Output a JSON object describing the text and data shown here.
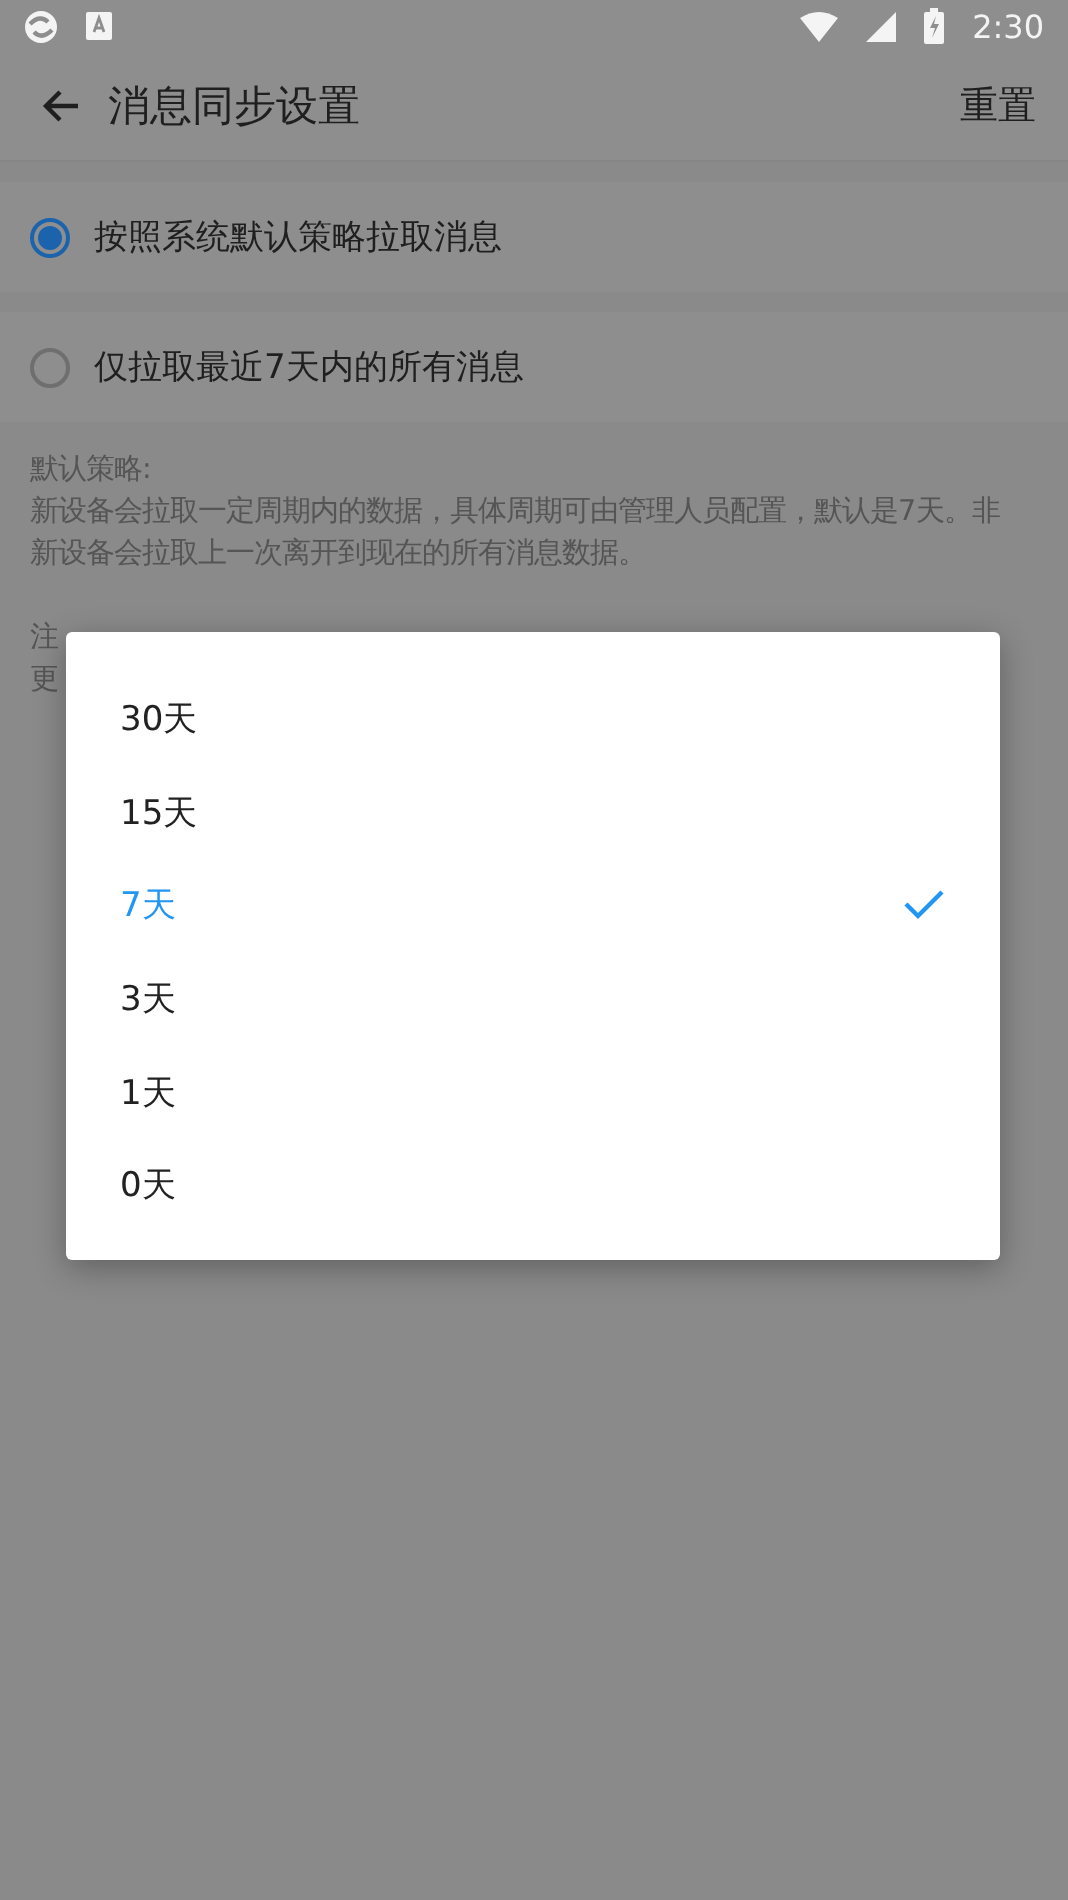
{
  "status_bar": {
    "time": "2:30"
  },
  "app_bar": {
    "title": "消息同步设置",
    "action": "重置"
  },
  "options": [
    {
      "label": "按照系统默认策略拉取消息",
      "selected": true
    },
    {
      "label": "仅拉取最近7天内的所有消息",
      "selected": false
    }
  ],
  "notes": [
    {
      "title": "默认策略:",
      "body": "新设备会拉取一定周期内的数据，具体周期可由管理人员配置，默认是7天。非新设备会拉取上一次离开到现在的所有消息数据。"
    },
    {
      "title": "注",
      "body": "更"
    }
  ],
  "dialog": {
    "items": [
      {
        "label": "30天",
        "selected": false
      },
      {
        "label": "15天",
        "selected": false
      },
      {
        "label": "7天",
        "selected": true
      },
      {
        "label": "3天",
        "selected": false
      },
      {
        "label": "1天",
        "selected": false
      },
      {
        "label": "0天",
        "selected": false
      }
    ]
  }
}
